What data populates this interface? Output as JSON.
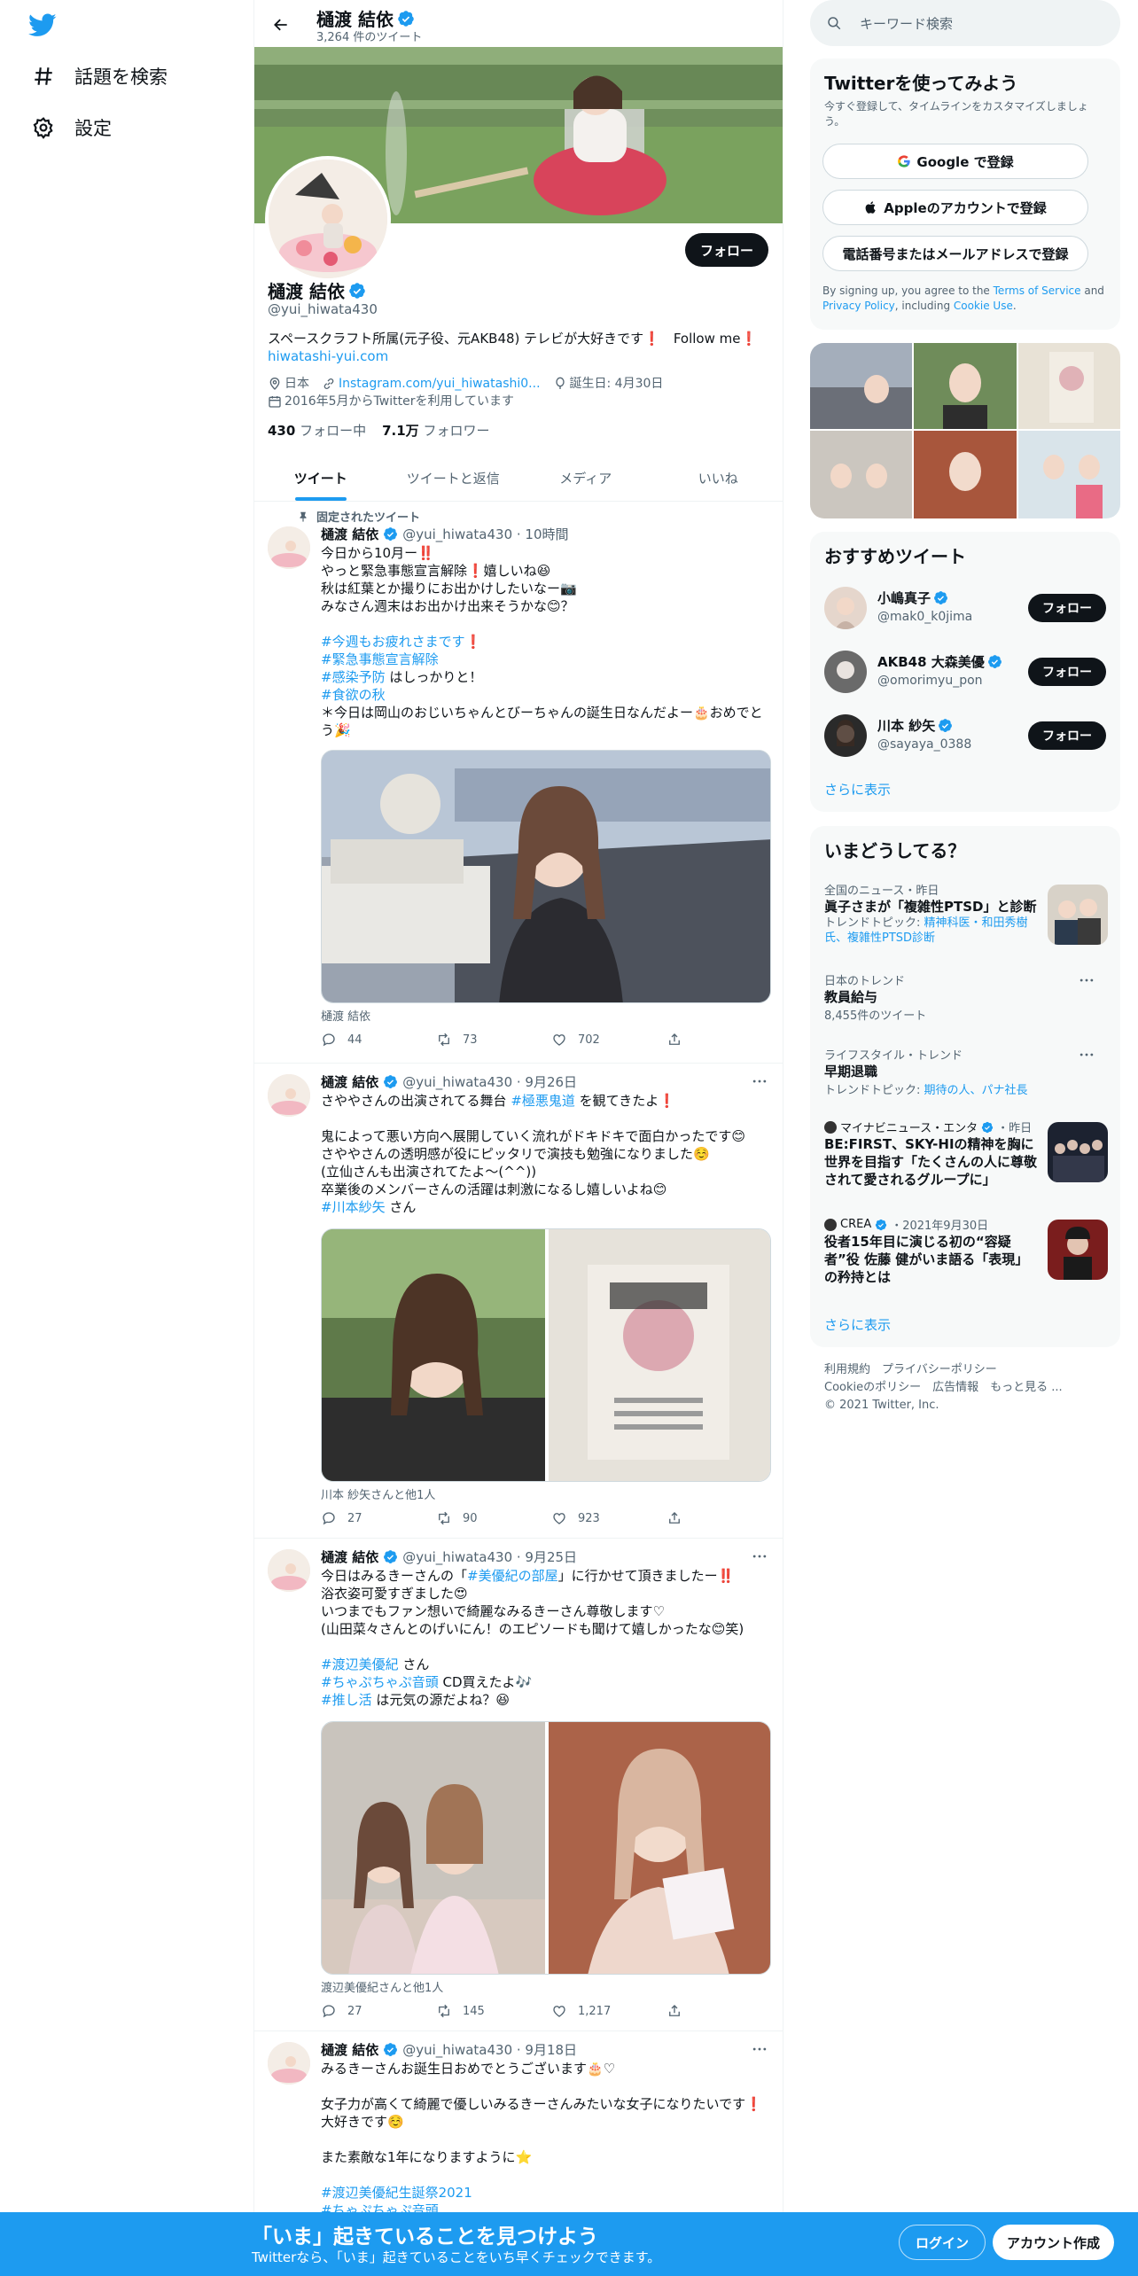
{
  "nav": {
    "explore": "話題を検索",
    "settings": "設定"
  },
  "header": {
    "name": "樋渡 結依",
    "tweet_count": "3,264 件のツイート"
  },
  "profile": {
    "follow": "フォロー",
    "name": "樋渡 結依",
    "handle": "@yui_hiwata430",
    "bio": "スペースクラフト所属(元子役、元AKB48) テレビが大好きです❗️　Follow me❗️",
    "site": "hiwatashi-yui.com",
    "location": "日本",
    "link": "Instagram.com/yui_hiwatashi0...",
    "birthday": "誕生日: 4月30日",
    "joined": "2016年5月からTwitterを利用しています",
    "following_count": "430",
    "following_label": "フォロー中",
    "followers_count": "7.1万",
    "followers_label": "フォロワー"
  },
  "tabs": [
    "ツイート",
    "ツイートと返信",
    "メディア",
    "いいね"
  ],
  "tweets": [
    {
      "pinned": "固定されたツイート",
      "name": "樋渡 結依",
      "meta": "@yui_hiwata430 · 10時間",
      "l1": "今日から10月ー‼️",
      "l2": "やっと緊急事態宣言解除❗️嬉しいね😆",
      "l3": "秋は紅葉とか撮りにお出かけしたいなー📷",
      "l4": "みなさん週末はお出かけ出来そうかな😊？",
      "h1": "#今週もお疲れさまです",
      "h1s": "❗️",
      "h2": "#緊急事態宣言解除",
      "h3": "#感染予防",
      "h3s": " はしっかりと！",
      "h4": "#食欲の秋",
      "l5": "＊今日は岡山のおじいちゃんとびーちゃんの誕生日なんだよー🎂おめでとう🎉",
      "caption": "樋渡 結依",
      "replies": "44",
      "retweets": "73",
      "likes": "702"
    },
    {
      "name": "樋渡 結依",
      "meta": "@yui_hiwata430 · 9月26日",
      "l1a": "さややさんの出演されてる舞台 ",
      "l1h": "#極悪鬼道",
      "l1b": " を観てきたよ❗️",
      "l2": "鬼によって悪い方向へ展開していく流れがドキドキで面白かったです😊",
      "l3": "さややさんの透明感が役にピッタリで演技も勉強になりました☺️",
      "l4": "(立仙さんも出演されてたよ〜(^^))",
      "l5": "卒業後のメンバーさんの活躍は刺激になるし嬉しいよね😊",
      "h1": "#川本紗矢",
      "h1s": " さん",
      "caption": "川本 紗矢さんと他1人",
      "replies": "27",
      "retweets": "90",
      "likes": "923"
    },
    {
      "name": "樋渡 結依",
      "meta": "@yui_hiwata430 · 9月25日",
      "l1a": "今日はみるきーさんの「",
      "l1h": "#美優紀の部屋",
      "l1b": "」に行かせて頂きましたー‼️",
      "l2": "浴衣姿可愛すぎました😍",
      "l3": "いつまでもファン想いで綺麗なみるきーさん尊敬します♡",
      "l4": "(山田菜々さんとのげいにん！のエピソードも聞けて嬉しかったな😊笑)",
      "h1": "#渡辺美優紀",
      "h1s": " さん",
      "h2": "#ちゃぷちゃぷ音頭",
      "h2s": " CD買えたよ🎶",
      "h3": "#推し活",
      "h3s": " は元気の源だよね？😆",
      "caption": "渡辺美優紀さんと他1人",
      "replies": "27",
      "retweets": "145",
      "likes": "1,217"
    },
    {
      "name": "樋渡 結依",
      "meta": "@yui_hiwata430 · 9月18日",
      "l1": "みるきーさんお誕生日おめでとうございます🎂♡",
      "l2": "女子力が高くて綺麗で優しいみるきーさんみたいな女子になりたいです❗️",
      "l3": "大好きです☺️",
      "l4": "また素敵な1年になりますように⭐️",
      "h1": "#渡辺美優紀生誕祭2021",
      "h2": "#ちゃぷちゃぷ音頭"
    }
  ],
  "right": {
    "search_placeholder": "キーワード検索",
    "signup_title": "Twitterを使ってみよう",
    "signup_sub": "今すぐ登録して、タイムラインをカスタマイズしましょう。",
    "google_btn": "Google で登録",
    "apple_btn": "Appleのアカウントで登録",
    "phone_btn": "電話番号またはメールアドレスで登録",
    "terms_a": "By signing up, you agree to the ",
    "terms_b": "Terms of Service",
    "terms_c": " and ",
    "terms_d": "Privacy Policy",
    "terms_e": ", including ",
    "terms_f": "Cookie Use",
    "terms_g": ".",
    "who_title": "おすすめツイート",
    "who": [
      {
        "name": "小嶋真子",
        "handle": "@mak0_k0jima"
      },
      {
        "name": "AKB48 大森美優",
        "handle": "@omorimyu_pon"
      },
      {
        "name": "川本 紗矢",
        "handle": "@sayaya_0388"
      }
    ],
    "follow": "フォロー",
    "show_more": "さらに表示",
    "trends_title": "いまどうしてる？",
    "trends": [
      {
        "cat": "全国のニュース・昨日",
        "title": "眞子さまが「複雑性PTSD」と診断",
        "topic_label": "トレンドトピック: ",
        "topic": "精神科医・和田秀樹氏、複雑性PTSD診断"
      },
      {
        "cat": "日本のトレンド",
        "title": "教員給与",
        "count": "8,455件のツイート"
      },
      {
        "cat": "ライフスタイル・トレンド",
        "title": "早期退職",
        "topic_label": "トレンドトピック: ",
        "topic": "期待の人、パナ社長"
      },
      {
        "src": "マイナビニュース・エンタ",
        "time": "・昨日",
        "title": "BE:FIRST、SKY-HIの精神を胸に世界を目指す「たくさんの人に尊敬されて愛されるグループに」"
      },
      {
        "src": "CREA",
        "time": "・2021年9月30日",
        "title": "役者15年目に演じる初の“容疑者”役 佐藤 健がいま語る「表現」の矜持とは"
      }
    ],
    "footer_1": "利用規約　プライバシーポリシー",
    "footer_2": "Cookieのポリシー　広告情報　もっと見る ...",
    "footer_3": "© 2021 Twitter, Inc."
  },
  "bottom": {
    "title": "「いま」起きていることを見つけよう",
    "sub": "Twitterなら、「いま」起きていることをいち早くチェックできます。",
    "login": "ログイン",
    "signup": "アカウント作成"
  }
}
